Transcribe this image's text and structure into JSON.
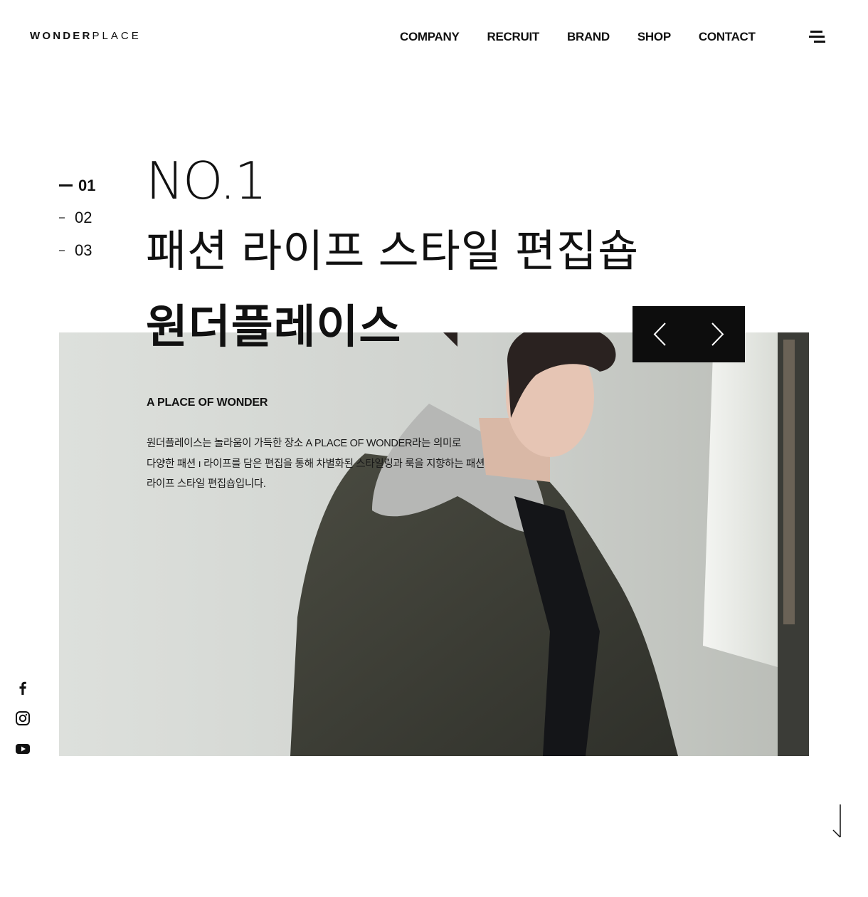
{
  "brand": {
    "logo_bold": "WONDER",
    "logo_light": "PLACE"
  },
  "nav": {
    "items": [
      "COMPANY",
      "RECRUIT",
      "BRAND",
      "SHOP",
      "CONTACT"
    ]
  },
  "menu": {
    "icon": "hamburger-menu-icon"
  },
  "slides": {
    "items": [
      "01",
      "02",
      "03"
    ],
    "active_index": 0
  },
  "hero": {
    "number": "NO.1",
    "title_line1": "패션 라이프 스타일 편집숍",
    "title_line2": "원더플레이스",
    "subtitle": "A PLACE OF WONDER",
    "description": [
      "원더플레이스는 놀라움이 가득한 장소 A PLACE OF WONDER라는 의미로",
      "다양한 패션 ı 라이프를 담은 편집을 통해 차별화된 스타일링과 룩을 지향하는 패션",
      "라이프 스타일 편집숍입니다."
    ]
  },
  "controls": {
    "prev_icon": "chevron-left-icon",
    "next_icon": "chevron-right-icon"
  },
  "social": {
    "icons": [
      "facebook-icon",
      "instagram-icon",
      "youtube-icon"
    ]
  },
  "scroll": {
    "icon": "scroll-down-arrow-icon"
  },
  "colors": {
    "text": "#111111",
    "control_bg": "#0d0d0d",
    "hero_bg": "#d5d8d4"
  }
}
